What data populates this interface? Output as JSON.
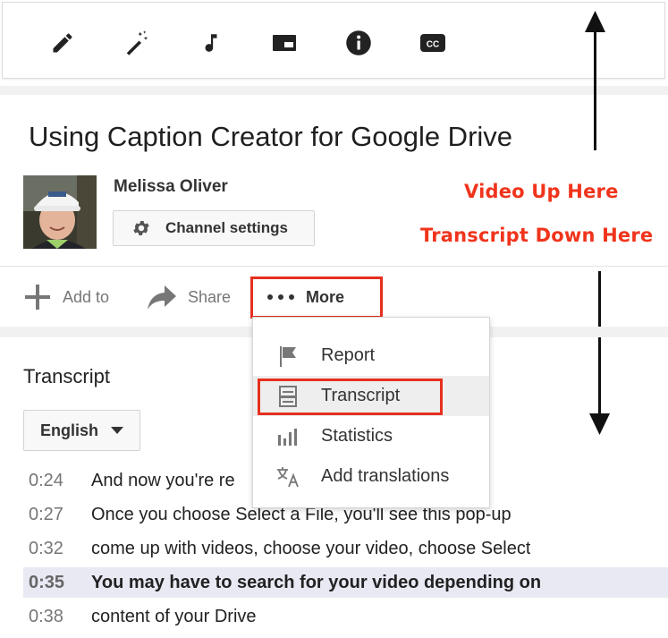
{
  "toolbar": {
    "icons": [
      "pencil-icon",
      "magic-wand-icon",
      "music-note-icon",
      "card-icon",
      "info-icon",
      "closed-captions-icon"
    ],
    "cc_label": "CC"
  },
  "video": {
    "title": "Using Caption Creator for Google Drive",
    "owner": "Melissa Oliver",
    "channel_settings_label": "Channel settings"
  },
  "annotations": {
    "up": "Video Up Here",
    "down": "Transcript Down Here",
    "color": "#f0341c"
  },
  "actions": {
    "add_to": "Add to",
    "share": "Share",
    "more": "More"
  },
  "more_menu": {
    "items": [
      {
        "label": "Report",
        "icon": "flag-icon"
      },
      {
        "label": "Transcript",
        "icon": "transcript-icon"
      },
      {
        "label": "Statistics",
        "icon": "bar-chart-icon"
      },
      {
        "label": "Add translations",
        "icon": "translate-icon"
      }
    ],
    "highlighted": "Transcript"
  },
  "transcript": {
    "heading": "Transcript",
    "language": "English",
    "rows": [
      {
        "time": "0:24",
        "text": "And now you're re"
      },
      {
        "time": "0:27",
        "text": "Once you choose Select a File, you'll see this pop-up"
      },
      {
        "time": "0:32",
        "text": "come up with videos, choose your video, choose Select"
      },
      {
        "time": "0:35",
        "text": "You may have to search for your video depending on"
      },
      {
        "time": "0:38",
        "text": "content of your Drive"
      }
    ],
    "active_index": 3
  },
  "colors": {
    "highlight_box": "#e5301e",
    "active_row": "#e9e9f4"
  }
}
